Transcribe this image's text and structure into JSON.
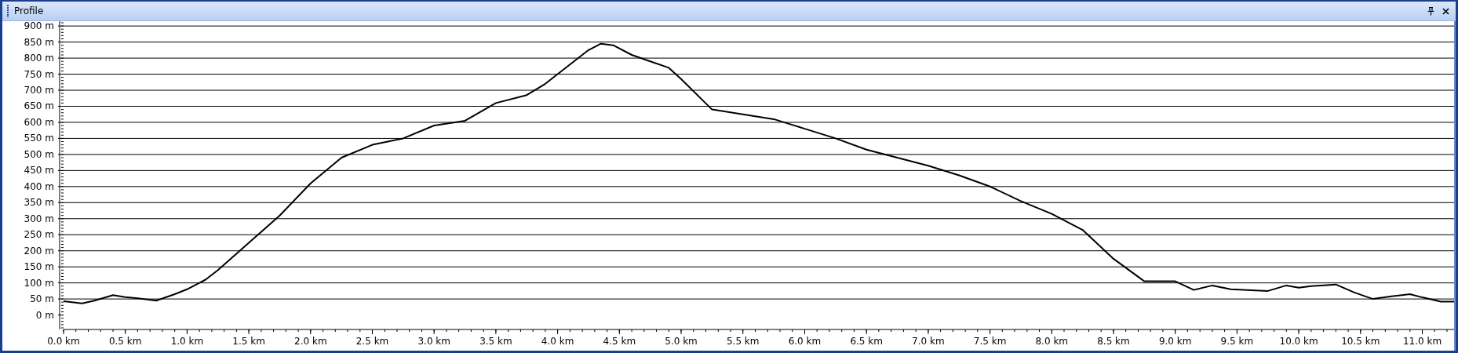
{
  "window": {
    "title": "Profile"
  },
  "chart_data": {
    "type": "line",
    "grid": true,
    "xlim": [
      0,
      11.27
    ],
    "ylim": [
      -45,
      915
    ],
    "x": [
      0,
      0.15,
      0.25,
      0.4,
      0.5,
      0.6,
      0.75,
      0.9,
      1.0,
      1.15,
      1.25,
      1.5,
      1.75,
      2.0,
      2.25,
      2.5,
      2.75,
      3.0,
      3.25,
      3.5,
      3.75,
      3.9,
      4.0,
      4.25,
      4.35,
      4.45,
      4.6,
      4.75,
      4.9,
      5.0,
      5.25,
      5.5,
      5.75,
      6.0,
      6.25,
      6.5,
      6.75,
      7.0,
      7.25,
      7.5,
      7.75,
      8.0,
      8.25,
      8.5,
      8.75,
      9.0,
      9.15,
      9.3,
      9.45,
      9.75,
      9.9,
      10.0,
      10.1,
      10.3,
      10.45,
      10.6,
      10.75,
      10.9,
      11.0,
      11.15,
      11.27
    ],
    "values": [
      43,
      36,
      45,
      62,
      56,
      52,
      45,
      65,
      80,
      110,
      140,
      225,
      310,
      410,
      490,
      530,
      550,
      590,
      605,
      660,
      685,
      720,
      750,
      825,
      845,
      840,
      810,
      790,
      770,
      735,
      640,
      625,
      610,
      580,
      550,
      515,
      490,
      465,
      435,
      400,
      355,
      315,
      265,
      175,
      105,
      105,
      78,
      92,
      80,
      75,
      92,
      85,
      90,
      95,
      70,
      50,
      58,
      65,
      55,
      42,
      42
    ],
    "xticks": [
      {
        "value": 0,
        "label": "0.0 km"
      },
      {
        "value": 0.5,
        "label": "0.5 km"
      },
      {
        "value": 1,
        "label": "1.0 km"
      },
      {
        "value": 1.5,
        "label": "1.5 km"
      },
      {
        "value": 2,
        "label": "2.0 km"
      },
      {
        "value": 2.5,
        "label": "2.5 km"
      },
      {
        "value": 3,
        "label": "3.0 km"
      },
      {
        "value": 3.5,
        "label": "3.5 km"
      },
      {
        "value": 4,
        "label": "4.0 km"
      },
      {
        "value": 4.5,
        "label": "4.5 km"
      },
      {
        "value": 5,
        "label": "5.0 km"
      },
      {
        "value": 5.5,
        "label": "5.5 km"
      },
      {
        "value": 6,
        "label": "6.0 km"
      },
      {
        "value": 6.5,
        "label": "6.5 km"
      },
      {
        "value": 7,
        "label": "7.0 km"
      },
      {
        "value": 7.5,
        "label": "7.5 km"
      },
      {
        "value": 8,
        "label": "8.0 km"
      },
      {
        "value": 8.5,
        "label": "8.5 km"
      },
      {
        "value": 9,
        "label": "9.0 km"
      },
      {
        "value": 9.5,
        "label": "9.5 km"
      },
      {
        "value": 10,
        "label": "10.0 km"
      },
      {
        "value": 10.5,
        "label": "10.5 km"
      },
      {
        "value": 11,
        "label": "11.0 km"
      }
    ],
    "yticks": [
      {
        "value": 0,
        "label": "0 m"
      },
      {
        "value": 50,
        "label": "50 m"
      },
      {
        "value": 100,
        "label": "100 m"
      },
      {
        "value": 150,
        "label": "150 m"
      },
      {
        "value": 200,
        "label": "200 m"
      },
      {
        "value": 250,
        "label": "250 m"
      },
      {
        "value": 300,
        "label": "300 m"
      },
      {
        "value": 350,
        "label": "350 m"
      },
      {
        "value": 400,
        "label": "400 m"
      },
      {
        "value": 450,
        "label": "450 m"
      },
      {
        "value": 500,
        "label": "500 m"
      },
      {
        "value": 550,
        "label": "550 m"
      },
      {
        "value": 600,
        "label": "600 m"
      },
      {
        "value": 650,
        "label": "650 m"
      },
      {
        "value": 700,
        "label": "700 m"
      },
      {
        "value": 750,
        "label": "750 m"
      },
      {
        "value": 800,
        "label": "800 m"
      },
      {
        "value": 850,
        "label": "850 m"
      },
      {
        "value": 900,
        "label": "900 m"
      }
    ]
  }
}
